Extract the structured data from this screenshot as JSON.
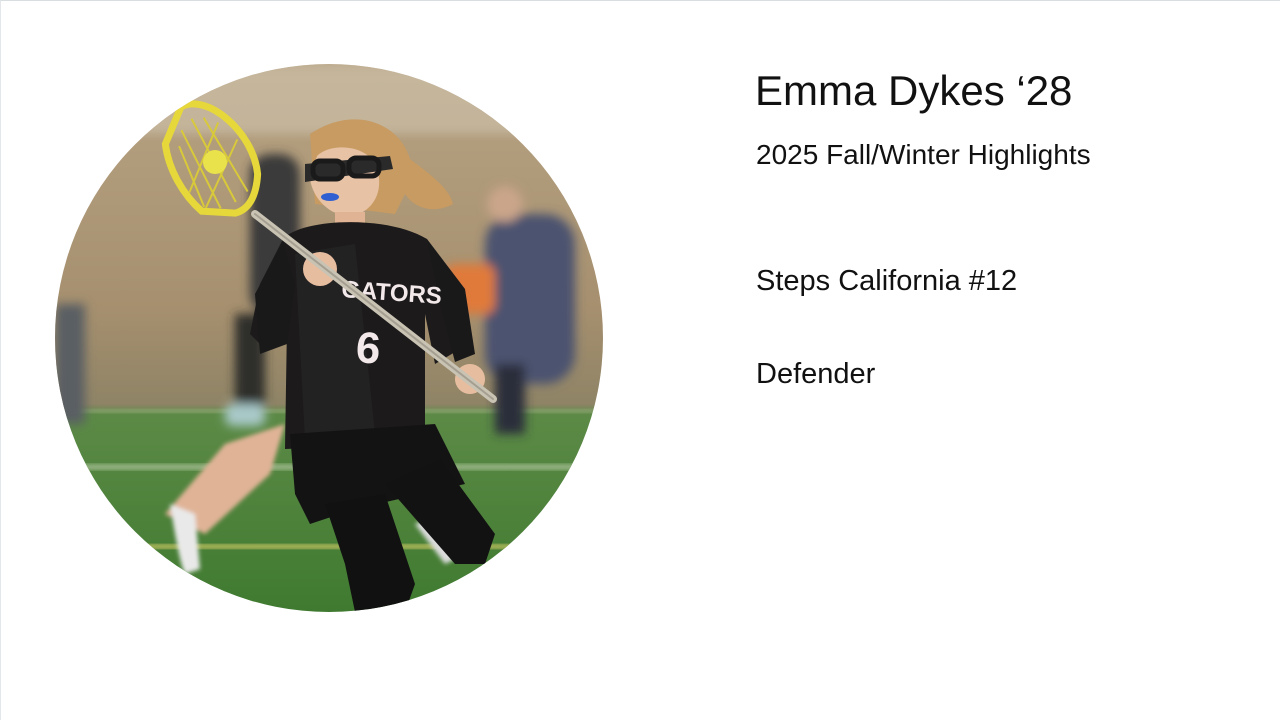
{
  "profile": {
    "name": "Emma Dykes ‘28",
    "subtitle": "2025 Fall/Winter Highlights",
    "team": "Steps California #12",
    "position": "Defender",
    "jersey_text": "GATORS",
    "jersey_number": "6"
  },
  "colors": {
    "text": "#111111",
    "background": "#ffffff",
    "turf": "#4f8a3a",
    "jersey": "#1c1a1b",
    "stick_head": "#e6d83a"
  }
}
